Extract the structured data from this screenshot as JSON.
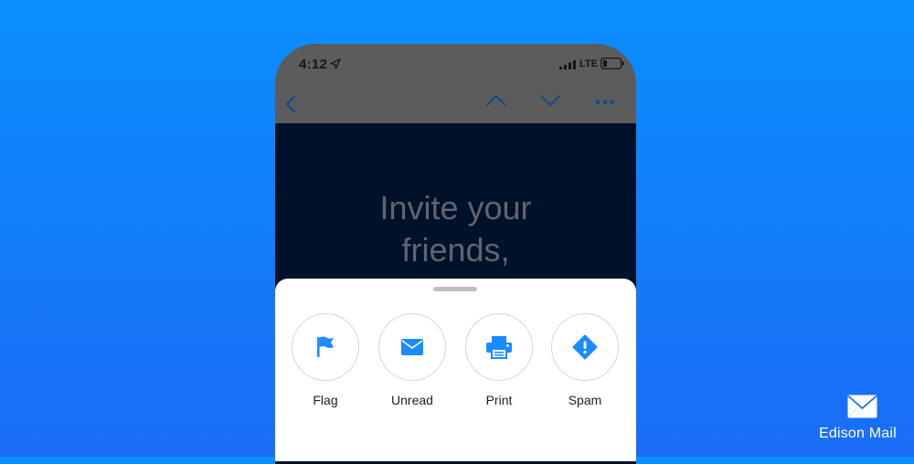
{
  "status_bar": {
    "time": "4:12",
    "network": "LTE",
    "icons": [
      "location-arrow-icon",
      "signal-bars-icon",
      "battery-icon"
    ]
  },
  "nav_bar": {
    "icons": [
      "back-chevron-icon",
      "chevron-up-icon",
      "chevron-down-icon",
      "more-dots-icon"
    ]
  },
  "email": {
    "headline_line1": "Invite your",
    "headline_line2": "friends,"
  },
  "action_sheet": {
    "actions": [
      {
        "label": "Flag",
        "icon": "flag-icon"
      },
      {
        "label": "Unread",
        "icon": "envelope-icon"
      },
      {
        "label": "Print",
        "icon": "printer-icon"
      },
      {
        "label": "Spam",
        "icon": "spam-warning-icon"
      }
    ]
  },
  "brand": {
    "name": "Edison Mail",
    "logo": "edison-mail-logo"
  },
  "colors": {
    "background_top": "#0a8ffc",
    "background_bottom": "#1a6cf7",
    "accent": "#1a8cff",
    "overlay": "#5c5c5c",
    "email_background": "#00112a"
  }
}
